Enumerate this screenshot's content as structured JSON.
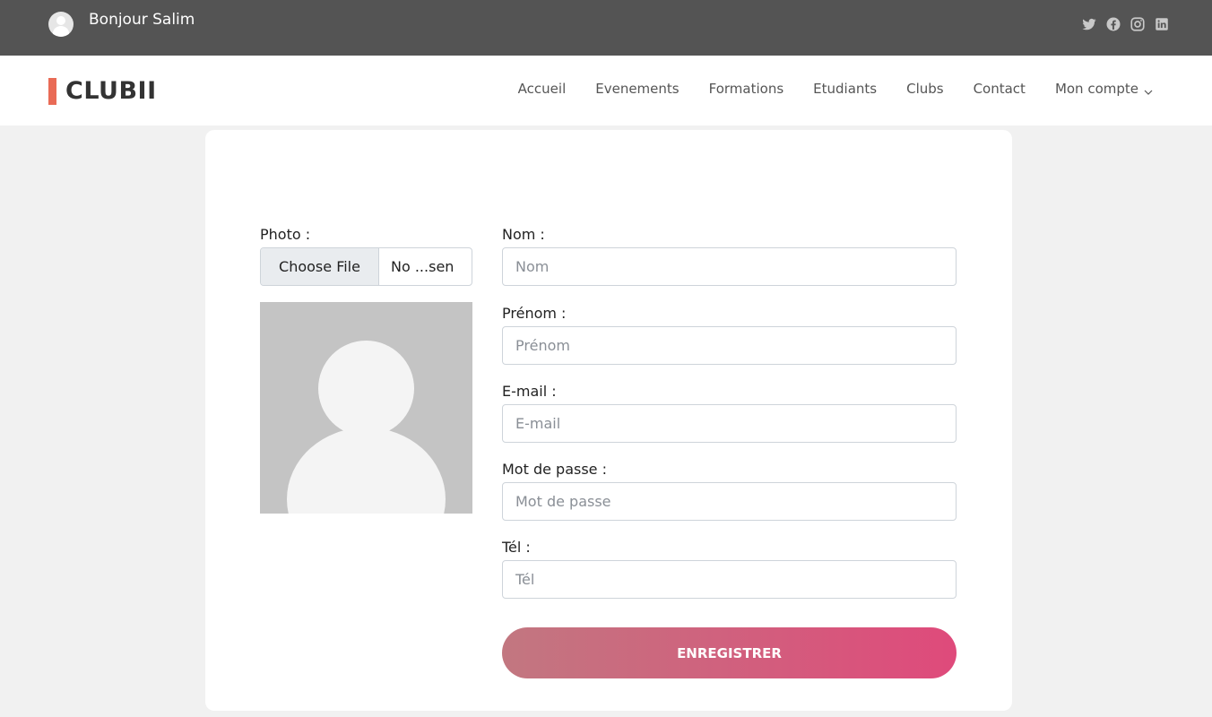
{
  "topbar": {
    "greeting": "Bonjour Salim",
    "avatar_icon": "user-avatar-icon",
    "social_icons": [
      "twitter-icon",
      "facebook-icon",
      "instagram-icon",
      "linkedin-icon"
    ]
  },
  "navbar": {
    "logo": "CLUBII",
    "items": [
      "Accueil",
      "Evenements",
      "Formations",
      "Etudiants",
      "Clubs",
      "Contact",
      "Mon compte"
    ],
    "dropdown_icon": "chevron-down-icon"
  },
  "form": {
    "photo_label": "Photo :",
    "file_button": "Choose File",
    "file_name": "No ...sen",
    "fields": [
      {
        "label": "Nom :",
        "placeholder": "Nom"
      },
      {
        "label": "Prénom :",
        "placeholder": "Prénom"
      },
      {
        "label": "E-mail :",
        "placeholder": "E-mail"
      },
      {
        "label": "Mot de passe :",
        "placeholder": "Mot de passe"
      },
      {
        "label": "Tél :",
        "placeholder": "Tél"
      }
    ],
    "submit": "ENREGISTRER"
  },
  "colors": {
    "topbar": "#545454",
    "accent": "#e96b56",
    "button_start": "#c27780",
    "button_end": "#df4a7b"
  }
}
